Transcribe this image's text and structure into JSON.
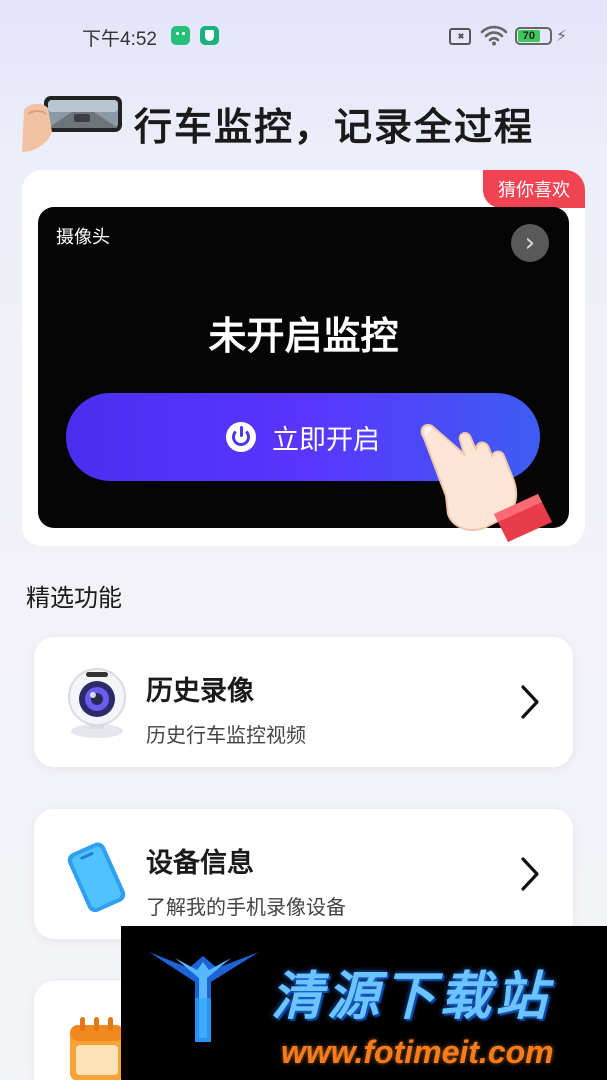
{
  "status_bar": {
    "time": "下午4:52",
    "battery_level": "70",
    "battery_percent": 70
  },
  "header": {
    "title": "行车监控，记录全过程"
  },
  "monitor_card": {
    "badge": "猜你喜欢",
    "camera_label": "摄像头",
    "status_text": "未开启监控",
    "start_button_label": "立即开启"
  },
  "section": {
    "title": "精选功能"
  },
  "features": [
    {
      "title": "历史录像",
      "subtitle": "历史行车监控视频",
      "icon": "webcam-icon"
    },
    {
      "title": "设备信息",
      "subtitle": "了解我的手机录像设备",
      "icon": "phone-icon"
    },
    {
      "title": "",
      "subtitle": "",
      "icon": "calendar-icon"
    }
  ],
  "watermark": {
    "site_name": "清源下载站",
    "url": "www.fotimeit.com"
  },
  "colors": {
    "accent_gradient_start": "#4a2ff0",
    "accent_gradient_end": "#3e5df2",
    "badge_red": "#f04452",
    "camera_panel": "#050505"
  }
}
